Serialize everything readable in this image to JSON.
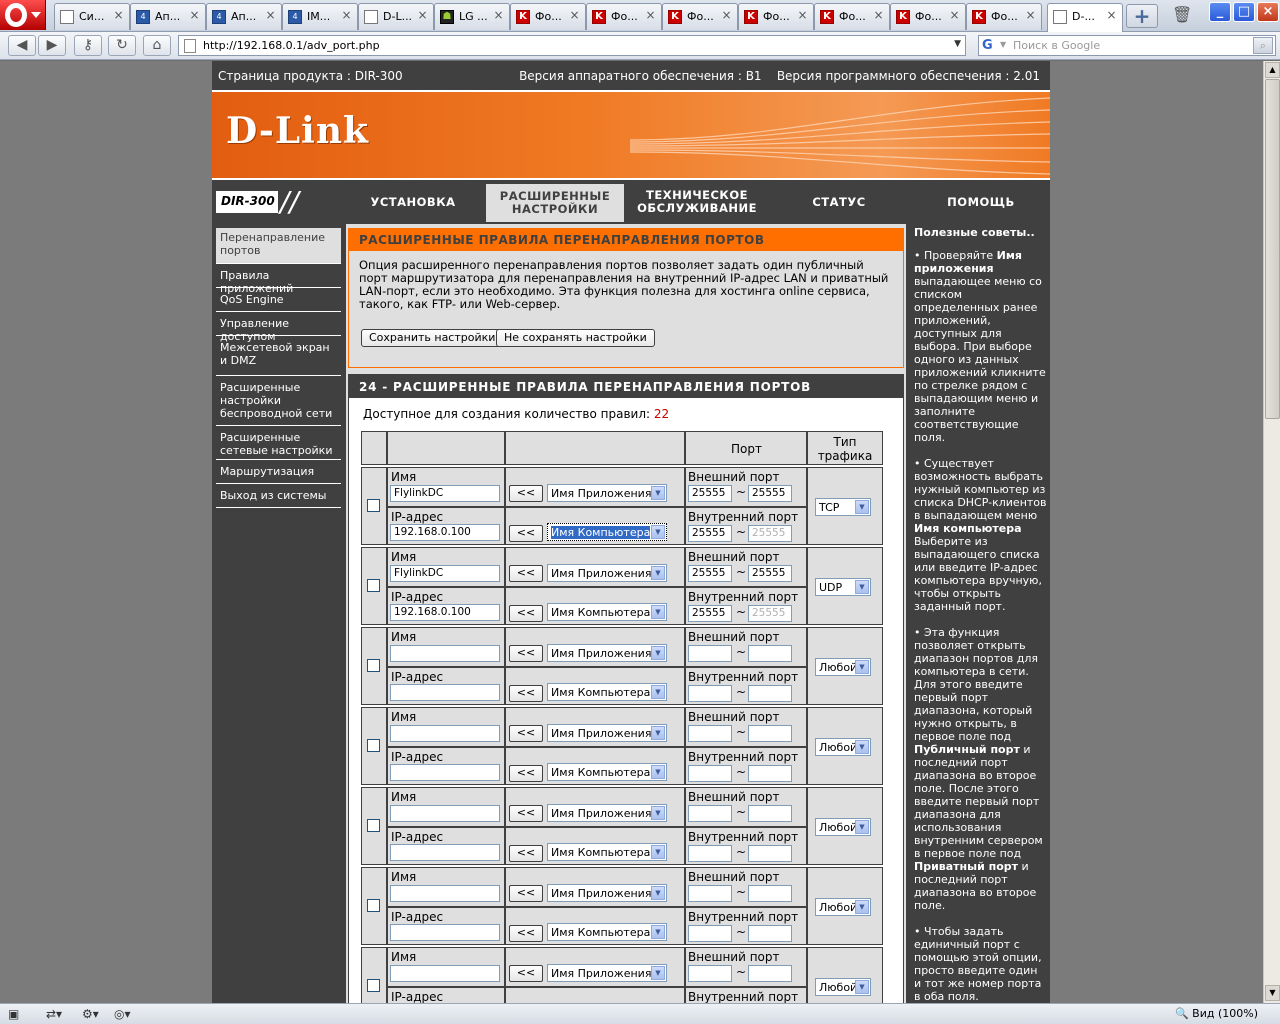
{
  "browser": {
    "tabs": [
      {
        "label": "Си...",
        "icon": "doc"
      },
      {
        "label": "Ап...",
        "icon": "d"
      },
      {
        "label": "Ап...",
        "icon": "d"
      },
      {
        "label": "IM...",
        "icon": "d"
      },
      {
        "label": "D-L...",
        "icon": "doc"
      },
      {
        "label": "LG ...",
        "icon": "lg"
      },
      {
        "label": "Фо...",
        "icon": "k"
      },
      {
        "label": "Фо...",
        "icon": "k"
      },
      {
        "label": "Фо...",
        "icon": "k"
      },
      {
        "label": "Фо...",
        "icon": "k"
      },
      {
        "label": "Фо...",
        "icon": "k"
      },
      {
        "label": "Фо...",
        "icon": "k"
      },
      {
        "label": "Фо...",
        "icon": "k"
      },
      {
        "label": "D-...",
        "icon": "doc"
      }
    ],
    "url": "http://192.168.0.1/adv_port.php",
    "search_placeholder": "Поиск в Google",
    "zoom_label": "Вид (100%)"
  },
  "header": {
    "product_page": "Страница продукта :  DIR-300",
    "versions": "Версия аппаратного обеспечения : B1    Версия программного обеспечения : 2.01",
    "logo": "D-Link",
    "model": "DIR-300"
  },
  "menu": [
    {
      "label": "УСТАНОВКА",
      "active": false
    },
    {
      "label": "РАСШИРЕННЫЕ НАСТРОЙКИ",
      "active": true
    },
    {
      "label": "ТЕХНИЧЕСКОЕ ОБСЛУЖИВАНИЕ",
      "active": false
    },
    {
      "label": "СТАТУС",
      "active": false
    },
    {
      "label": "ПОМОЩЬ",
      "active": false
    }
  ],
  "sidebar": [
    {
      "label": "Перенаправление портов",
      "active": true
    },
    {
      "label": "Правила приложений",
      "active": false
    },
    {
      "label": "QoS Engine",
      "active": false
    },
    {
      "label": "Управление доступом",
      "active": false
    },
    {
      "label": "Межсетевой экран и DMZ",
      "active": false
    },
    {
      "label": "Расширенные настройки беспроводной сети",
      "active": false
    },
    {
      "label": "Расширенные сетевые настройки",
      "active": false
    },
    {
      "label": "Маршрутизация",
      "active": false
    },
    {
      "label": "Выход из системы",
      "active": false
    }
  ],
  "intro": {
    "title": "РАСШИРЕННЫЕ ПРАВИЛА ПЕРЕНАПРАВЛЕНИЯ ПОРТОВ",
    "text": "Опция расширенного перенаправления портов позволяет задать один публичный порт маршрутизатора для перенаправления на внутренний IP-адрес LAN и приватный LAN-порт, если это необходимо. Эта функция полезна для хостинга online сервиса, такого, как FTP- или Web-сервер.",
    "save_button": "Сохранить настройки",
    "cancel_button": "Не сохранять настройки"
  },
  "rules": {
    "title": "24 - РАСШИРЕННЫЕ ПРАВИЛА ПЕРЕНАПРАВЛЕНИЯ ПОРТОВ",
    "available_label": "Доступное для создания количество правил:",
    "available_count": "22",
    "col_port": "Порт",
    "col_traffic": "Тип трафика",
    "name_label": "Имя",
    "ip_label": "IP-адрес",
    "ext_port_label": "Внешний порт",
    "int_port_label": "Внутренний порт",
    "arrow_button": "<<",
    "app_select": "Имя Приложения",
    "pc_select": "Имя Компьютера",
    "tilde": "~",
    "rows": [
      {
        "name": "FlylinkDC",
        "ip": "192.168.0.100",
        "ext_from": "25555",
        "ext_to": "25555",
        "int_from": "25555",
        "int_to": "25555",
        "traffic": "TCP"
      },
      {
        "name": "FlylinkDC",
        "ip": "192.168.0.100",
        "ext_from": "25555",
        "ext_to": "25555",
        "int_from": "25555",
        "int_to": "25555",
        "traffic": "UDP"
      },
      {
        "name": "",
        "ip": "",
        "ext_from": "",
        "ext_to": "",
        "int_from": "",
        "int_to": "",
        "traffic": "Любой"
      },
      {
        "name": "",
        "ip": "",
        "ext_from": "",
        "ext_to": "",
        "int_from": "",
        "int_to": "",
        "traffic": "Любой"
      },
      {
        "name": "",
        "ip": "",
        "ext_from": "",
        "ext_to": "",
        "int_from": "",
        "int_to": "",
        "traffic": "Любой"
      },
      {
        "name": "",
        "ip": "",
        "ext_from": "",
        "ext_to": "",
        "int_from": "",
        "int_to": "",
        "traffic": "Любой"
      },
      {
        "name": "",
        "ip": "",
        "ext_from": "",
        "ext_to": "",
        "int_from": "",
        "int_to": "",
        "traffic": "Любой"
      }
    ],
    "partial_ip_label": "IP-адрес",
    "partial_int_label": "Внутренний порт"
  },
  "hints": {
    "title": "Полезные советы..",
    "p1_pre": "• Проверяйте ",
    "p1_bold": "Имя приложения",
    "p1_post": " выпадающее меню со списком определенных ранее приложений, доступных для выбора. При выборе одного из данных приложений кликните по стрелке рядом с выпадающим меню и заполните соответствующие поля.",
    "p2_pre": "• Существует возможность выбрать нужный компьютер из списка DHCP-клиентов в выпадающем меню ",
    "p2_bold": "Имя компьютера",
    "p2_post": " Выберите из выпадающего списка или введите IP-адрес компьютера вручную, чтобы открыть заданный порт.",
    "p3_pre": "• Эта функция позволяет открыть диапазон портов для компьютера в сети. Для этого введите первый порт диапазона, который нужно открыть, в первое поле под ",
    "p3_bold1": "Публичный порт",
    "p3_mid": " и последний порт диапазона во второе поле. После этого введите первый порт диапазона для использования внутренним сервером в первое поле под ",
    "p3_bold2": "Приватный порт",
    "p3_post": " и последний порт диапазона во второе поле.",
    "p4": "• Чтобы задать единичный порт с помощью этой опции, просто введите один и тот же номер порта в оба поля."
  }
}
